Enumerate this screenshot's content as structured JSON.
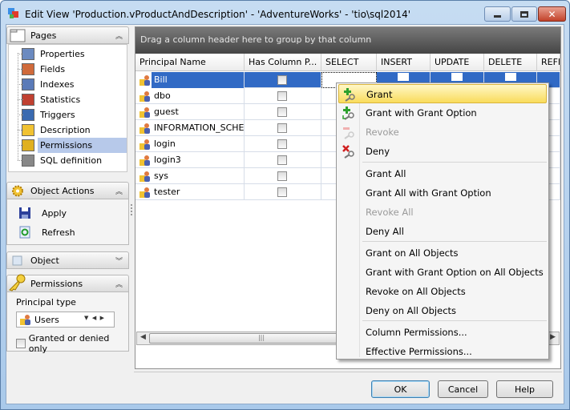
{
  "window": {
    "title": "Edit View 'Production.vProductAndDescription' - 'AdventureWorks' - 'tio\\sql2014'"
  },
  "pages": {
    "header": "Pages",
    "items": [
      {
        "label": "Properties",
        "icon": "properties-icon"
      },
      {
        "label": "Fields",
        "icon": "fields-icon"
      },
      {
        "label": "Indexes",
        "icon": "indexes-icon"
      },
      {
        "label": "Statistics",
        "icon": "statistics-icon"
      },
      {
        "label": "Triggers",
        "icon": "triggers-icon"
      },
      {
        "label": "Description",
        "icon": "description-icon"
      },
      {
        "label": "Permissions",
        "icon": "key-icon",
        "selected": true
      },
      {
        "label": "SQL definition",
        "icon": "sql-icon"
      }
    ]
  },
  "object_actions": {
    "header": "Object Actions",
    "apply": "Apply",
    "refresh": "Refresh"
  },
  "object_panel": {
    "header": "Object"
  },
  "permissions_panel": {
    "header": "Permissions",
    "principal_type_label": "Principal type",
    "principal_type_value": "Users",
    "granted_only_label": "Granted or denied only",
    "granted_only_checked": false
  },
  "grid": {
    "group_hint": "Drag a column header here to group by that column",
    "columns": [
      "Principal Name",
      "Has Column P...",
      "SELECT",
      "INSERT",
      "UPDATE",
      "DELETE",
      "REFE"
    ],
    "rows": [
      "Bill",
      "dbo",
      "guest",
      "INFORMATION_SCHEM",
      "login",
      "login3",
      "sys",
      "tester"
    ],
    "selected_row": "Bill",
    "selection_color": "#316ac5"
  },
  "context_menu": {
    "items": [
      {
        "label": "Grant",
        "icon": "grant-icon",
        "highlighted": true
      },
      {
        "label": "Grant with Grant Option",
        "icon": "grant-with-option-icon"
      },
      {
        "label": "Revoke",
        "icon": "revoke-icon",
        "disabled": true
      },
      {
        "label": "Deny",
        "icon": "deny-icon"
      },
      {
        "label": "Grant All"
      },
      {
        "label": "Grant All with Grant Option"
      },
      {
        "label": "Revoke All",
        "disabled": true
      },
      {
        "label": "Deny All"
      },
      {
        "label": "Grant on All Objects"
      },
      {
        "label": "Grant with Grant Option on All Objects"
      },
      {
        "label": "Revoke on All Objects"
      },
      {
        "label": "Deny on All Objects"
      },
      {
        "label": "Column Permissions..."
      },
      {
        "label": "Effective Permissions..."
      }
    ]
  },
  "buttons": {
    "ok": "OK",
    "cancel": "Cancel",
    "help": "Help"
  }
}
